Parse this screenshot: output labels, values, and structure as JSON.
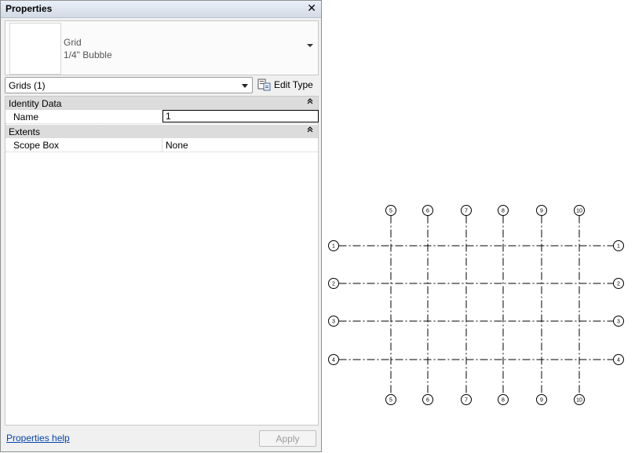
{
  "palette": {
    "title": "Properties",
    "close_glyph": "✕",
    "type": {
      "family": "Grid",
      "name": "1/4\" Bubble"
    },
    "instance_selector": "Grids (1)",
    "edit_type_label": "Edit Type",
    "groups": [
      {
        "label": "Identity Data",
        "rows": [
          {
            "name": "Name",
            "value": "1",
            "editing": true
          }
        ]
      },
      {
        "label": "Extents",
        "rows": [
          {
            "name": "Scope Box",
            "value": "None"
          }
        ]
      }
    ],
    "collapse_glyph": "«",
    "help_link": "Properties help",
    "apply_label": "Apply"
  },
  "drawing": {
    "vertical_grids": [
      "5",
      "6",
      "7",
      "8",
      "9",
      "10"
    ],
    "horizontal_grids": [
      "1",
      "2",
      "3",
      "4"
    ],
    "line_color": "#000000"
  }
}
